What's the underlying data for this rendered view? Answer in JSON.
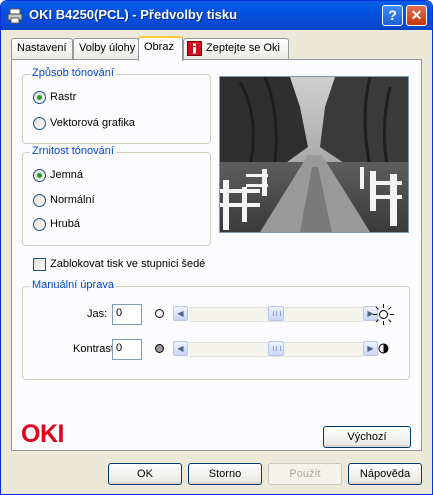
{
  "window": {
    "title": "OKI B4250(PCL) - Předvolby tisku",
    "help_glyph": "?",
    "close_glyph": "✕"
  },
  "tabs": [
    {
      "label": "Nastavení",
      "active": false
    },
    {
      "label": "Volby úlohy",
      "active": false
    },
    {
      "label": "Obraz",
      "active": true
    },
    {
      "label": "Zeptejte se Oki",
      "active": false
    }
  ],
  "method_group": {
    "title": "Způsob tónování",
    "options": [
      {
        "label": "Rastr",
        "checked": true
      },
      {
        "label": "Vektorová grafika",
        "checked": false
      }
    ]
  },
  "coarseness_group": {
    "title": "Zrnitost tónování",
    "options": [
      {
        "label": "Jemná",
        "checked": true
      },
      {
        "label": "Normální",
        "checked": false
      },
      {
        "label": "Hrubá",
        "checked": false
      }
    ]
  },
  "grayscale_checkbox": {
    "label": "Zablokovat tisk ve stupnici šedé",
    "checked": false
  },
  "manual_group": {
    "title": "Manuální úprava",
    "brightness": {
      "label": "Jas:",
      "value": "0",
      "level": 0.5
    },
    "contrast": {
      "label": "Kontrast:",
      "value": "0",
      "level": 0.5
    }
  },
  "default_button": "Výchozí",
  "logo_text": "OKI",
  "colors": {
    "logo_red": "#e3001b",
    "group_title": "#0046d5",
    "title_bar": "#0053e0"
  },
  "footer": {
    "ok": "OK",
    "cancel": "Storno",
    "apply": "Použít",
    "help": "Nápověda"
  }
}
